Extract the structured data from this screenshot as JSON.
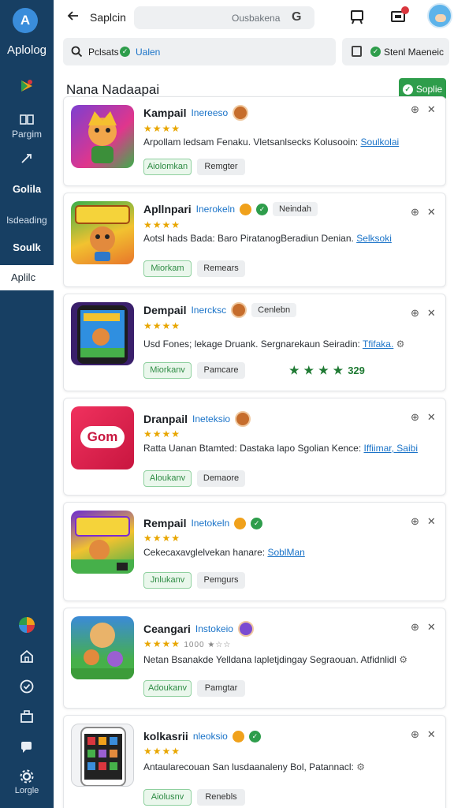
{
  "sidebar": {
    "logo_text": "Aplolog",
    "items": [
      {
        "label": "Pargim"
      },
      {
        "label": "Golila"
      },
      {
        "label": "lsdeading"
      },
      {
        "label": "Soulk"
      },
      {
        "label": "Aplilc"
      }
    ],
    "bottom_label": "Lorgle"
  },
  "topbar": {
    "title": "Saplcin",
    "search_placeholder": "Ousbakena",
    "search_icon_glyph": "G"
  },
  "filter": {
    "label": "Pclsats",
    "value": "Ualen",
    "right_label": "Stenl Maeneic"
  },
  "section": {
    "title": "Nana Nadaapai",
    "button_label": "Soplie"
  },
  "apps": [
    {
      "name": "Kampail",
      "developer": "Inereeso",
      "tag": "",
      "stars": "★★★★",
      "desc": "Arpollam ledsam Fenaku. Vletsanlsecks Kolusooin:",
      "link": "Soulkolai",
      "btn1": "Aiolomkan",
      "btn2": "Remgter"
    },
    {
      "name": "Apllnpari",
      "developer": "Inerokeln",
      "tag": "Neindah",
      "stars": "★★★★",
      "desc": "Aotsl hads Bada: Baro PiratanogBeradiun Denian.",
      "link": "Selksoki",
      "btn1": "Miorkam",
      "btn2": "Remears"
    },
    {
      "name": "Dempail",
      "developer": "Inercksc",
      "tag": "Cenlebn",
      "stars": "★★★★",
      "desc": "Usd Fones; lekage Druank. Sergnarekaun Seiradin:",
      "link": "Tfifaka.",
      "btn1": "Miorkanv",
      "btn2": "Pamcare",
      "rating": "329"
    },
    {
      "name": "Dranpail",
      "developer": "Ineteksio",
      "tag": "",
      "stars": "★★★★",
      "desc": "Ratta Uanan Btamted: Dastaka lapo Sgolian Kence:",
      "link": "Iffiimar, Saibi",
      "btn1": "Aloukanv",
      "btn2": "Demaore"
    },
    {
      "name": "Rempail",
      "developer": "Inetokeln",
      "tag": "",
      "stars": "★★★★",
      "desc": "Cekecaxavglelvekan hanare:",
      "link": "SoblMan",
      "btn1": "Jnlukanv",
      "btn2": "Pemgurs"
    },
    {
      "name": "Ceangari",
      "developer": "Instokeio",
      "tag": "",
      "stars": "★★★★",
      "stars_extra": "1000 ★☆☆",
      "desc": "Netan Bsanakde Yelldana lapletjdingay Segraouan. Atfidnlidl",
      "link": "",
      "btn1": "Adoukanv",
      "btn2": "Pamgtar"
    },
    {
      "name": "kolkasrii",
      "developer": "nleoksio",
      "tag": "",
      "stars": "★★★★",
      "desc": "Antaularecouan San lusdaanaleny Bol, Patannacl:",
      "link": "",
      "btn1": "Aiolusnv",
      "btn2": "Renebls"
    }
  ],
  "colors": {
    "sidebar": "#173f63",
    "accent_green": "#2e9d4b",
    "link_blue": "#1a73c8",
    "star": "#e8a600"
  }
}
